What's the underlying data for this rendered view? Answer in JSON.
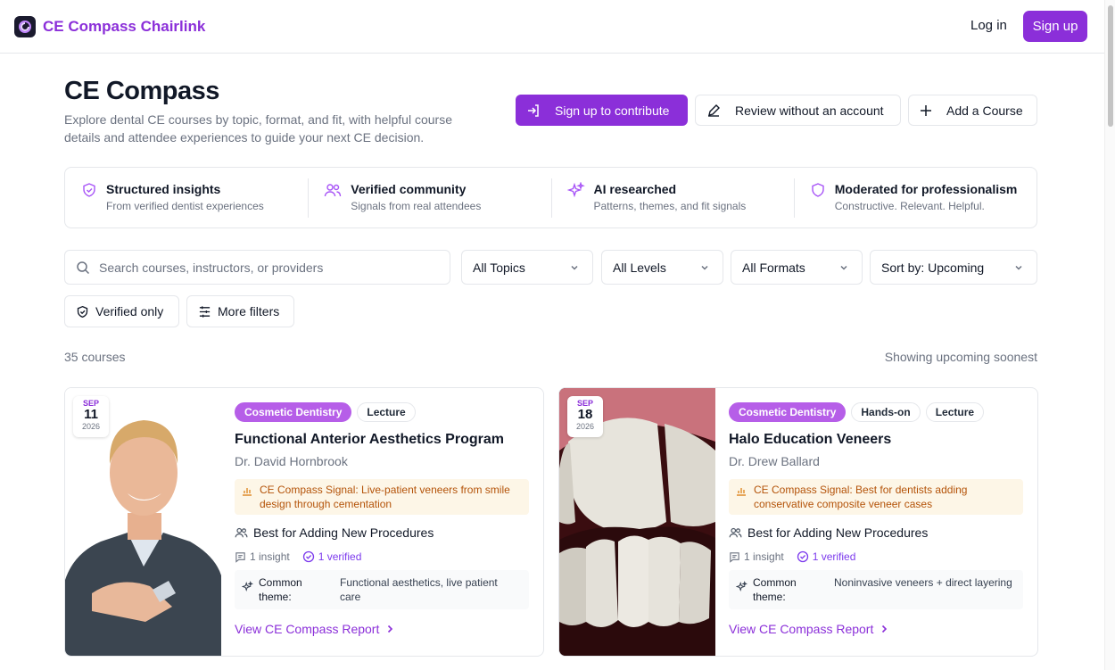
{
  "nav": {
    "brand": "CE Compass Chairlink",
    "login": "Log in",
    "signup": "Sign up"
  },
  "hero": {
    "title": "CE Compass",
    "subtitle": "Explore dental CE courses by topic, format, and fit, with helpful course details and attendee experiences to guide your next CE decision.",
    "buttons": {
      "contribute": "Sign up to contribute",
      "review": "Review without an account",
      "add": "Add a Course"
    }
  },
  "features": [
    {
      "title": "Structured insights",
      "sub": "From verified dentist experiences",
      "icon": "shield-check-icon"
    },
    {
      "title": "Verified community",
      "sub": "Signals from real attendees",
      "icon": "users-icon"
    },
    {
      "title": "AI researched",
      "sub": "Patterns, themes, and fit signals",
      "icon": "sparkles-icon"
    },
    {
      "title": "Moderated for professionalism",
      "sub": "Constructive. Relevant. Helpful.",
      "icon": "shield-icon"
    }
  ],
  "filters": {
    "search_placeholder": "Search courses, instructors, or providers",
    "topics": "All Topics",
    "levels": "All Levels",
    "formats": "All Formats",
    "sort": "Sort by: Upcoming",
    "verified_only": "Verified only",
    "more_filters": "More filters"
  },
  "results": {
    "count": "35 courses",
    "showing": "Showing upcoming soonest"
  },
  "courses": [
    {
      "month": "SEP",
      "day": "11",
      "year": "2026",
      "tags": [
        "Cosmetic Dentistry",
        "Lecture"
      ],
      "title": "Functional Anterior Aesthetics Program",
      "instructor": "Dr. David Hornbrook",
      "signal": "CE Compass Signal: Live-patient veneers from smile design through cementation",
      "best_for": "Best for Adding New Procedures",
      "insights": "1 insight",
      "verified": "1 verified",
      "theme_label": "Common theme:",
      "theme": "Functional aesthetics, live patient care",
      "link": "View CE Compass Report"
    },
    {
      "month": "SEP",
      "day": "18",
      "year": "2026",
      "tags": [
        "Cosmetic Dentistry",
        "Hands-on",
        "Lecture"
      ],
      "title": "Halo Education Veneers",
      "instructor": "Dr. Drew Ballard",
      "signal": "CE Compass Signal: Best for dentists adding conservative composite veneer cases",
      "best_for": "Best for Adding New Procedures",
      "insights": "1 insight",
      "verified": "1 verified",
      "theme_label": "Common theme:",
      "theme": "Noninvasive veneers + direct layering",
      "link": "View CE Compass Report"
    }
  ],
  "colors": {
    "brand": "#8b2fd9",
    "tag_purple": "#b65ee8",
    "signal_bg": "#fdf6e7",
    "signal_text": "#b45309"
  }
}
